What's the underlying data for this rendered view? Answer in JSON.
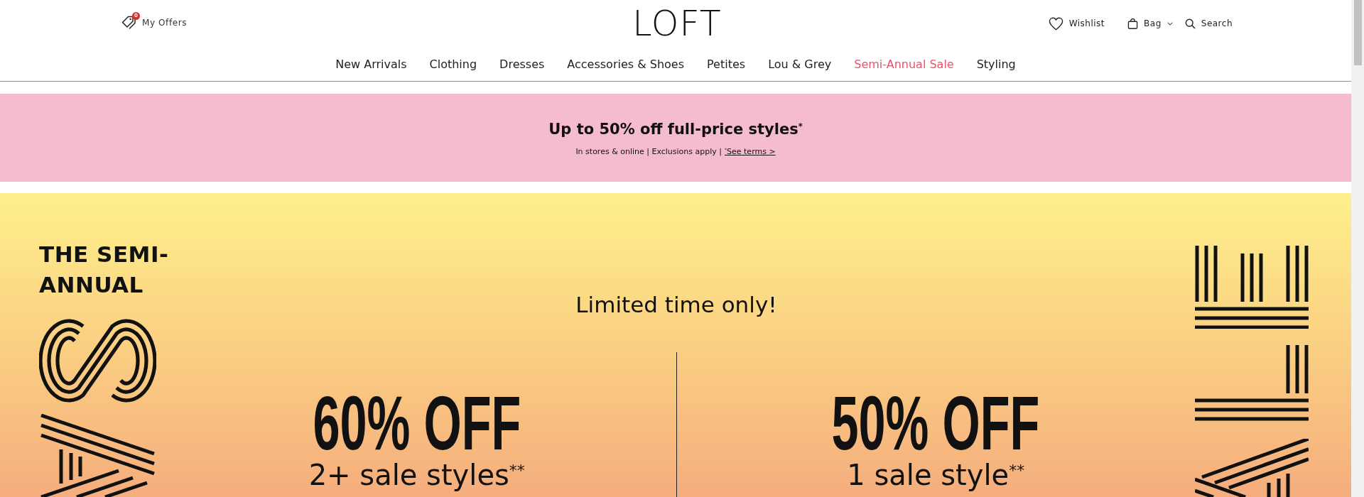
{
  "header": {
    "offers": {
      "label": "My Offers",
      "count": "0"
    },
    "logo": "LOFT",
    "utilities": [
      {
        "kind": "wishlist",
        "label": "Wishlist"
      },
      {
        "kind": "bag",
        "label": "Bag"
      },
      {
        "kind": "search",
        "label": "Search"
      }
    ]
  },
  "nav": [
    {
      "label": "New Arrivals",
      "highlighted": false
    },
    {
      "label": "Clothing",
      "highlighted": false
    },
    {
      "label": "Dresses",
      "highlighted": false
    },
    {
      "label": "Accessories & Shoes",
      "highlighted": false
    },
    {
      "label": "Petites",
      "highlighted": false
    },
    {
      "label": "Lou & Grey",
      "highlighted": false
    },
    {
      "label": "Semi-Annual Sale",
      "highlighted": true
    },
    {
      "label": "Styling",
      "highlighted": false
    }
  ],
  "promo_banner": {
    "heading": "Up to 50% off full-price styles$^{*}$",
    "note": "In stores & online | Exclusions apply |",
    "terms_link": "$^{*}$See terms >"
  },
  "hero": {
    "eyebrow": "THE SEMI-ANNUAL",
    "tagline": "Limited time only!",
    "offers": [
      {
        "discount": "60% OFF",
        "condition": "2+ sale styles$^{**}$"
      },
      {
        "discount": "50% OFF",
        "condition": "1 sale style$^{**}$"
      }
    ]
  }
}
